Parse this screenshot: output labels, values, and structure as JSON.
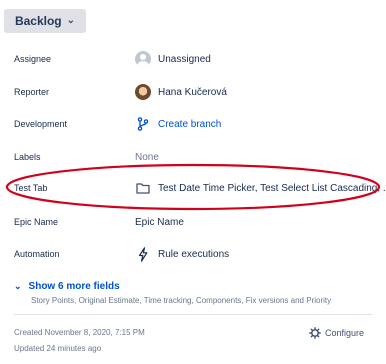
{
  "status": {
    "label": "Backlog"
  },
  "fields": {
    "assignee": {
      "label": "Assignee",
      "value": "Unassigned"
    },
    "reporter": {
      "label": "Reporter",
      "value": "Hana Kučerová"
    },
    "development": {
      "label": "Development",
      "value": "Create branch"
    },
    "labels": {
      "label": "Labels",
      "value": "None"
    },
    "test_tab": {
      "label": "Test Tab",
      "value": "Test Date Time Picker, Test Select List Cascading, ..."
    },
    "epic_name": {
      "label": "Epic Name",
      "value": "Epic Name"
    },
    "automation": {
      "label": "Automation",
      "value": "Rule executions"
    }
  },
  "more_fields": {
    "label": "Show 6 more fields",
    "summary": "Story Points, Original Estimate, Time tracking, Components, Fix versions and Priority"
  },
  "meta": {
    "created": "Created November 8, 2020, 7:15 PM",
    "updated": "Updated 24 minutes ago",
    "configure_label": "Configure"
  },
  "colors": {
    "link": "#0052cc",
    "annotation": "#d0021b"
  }
}
